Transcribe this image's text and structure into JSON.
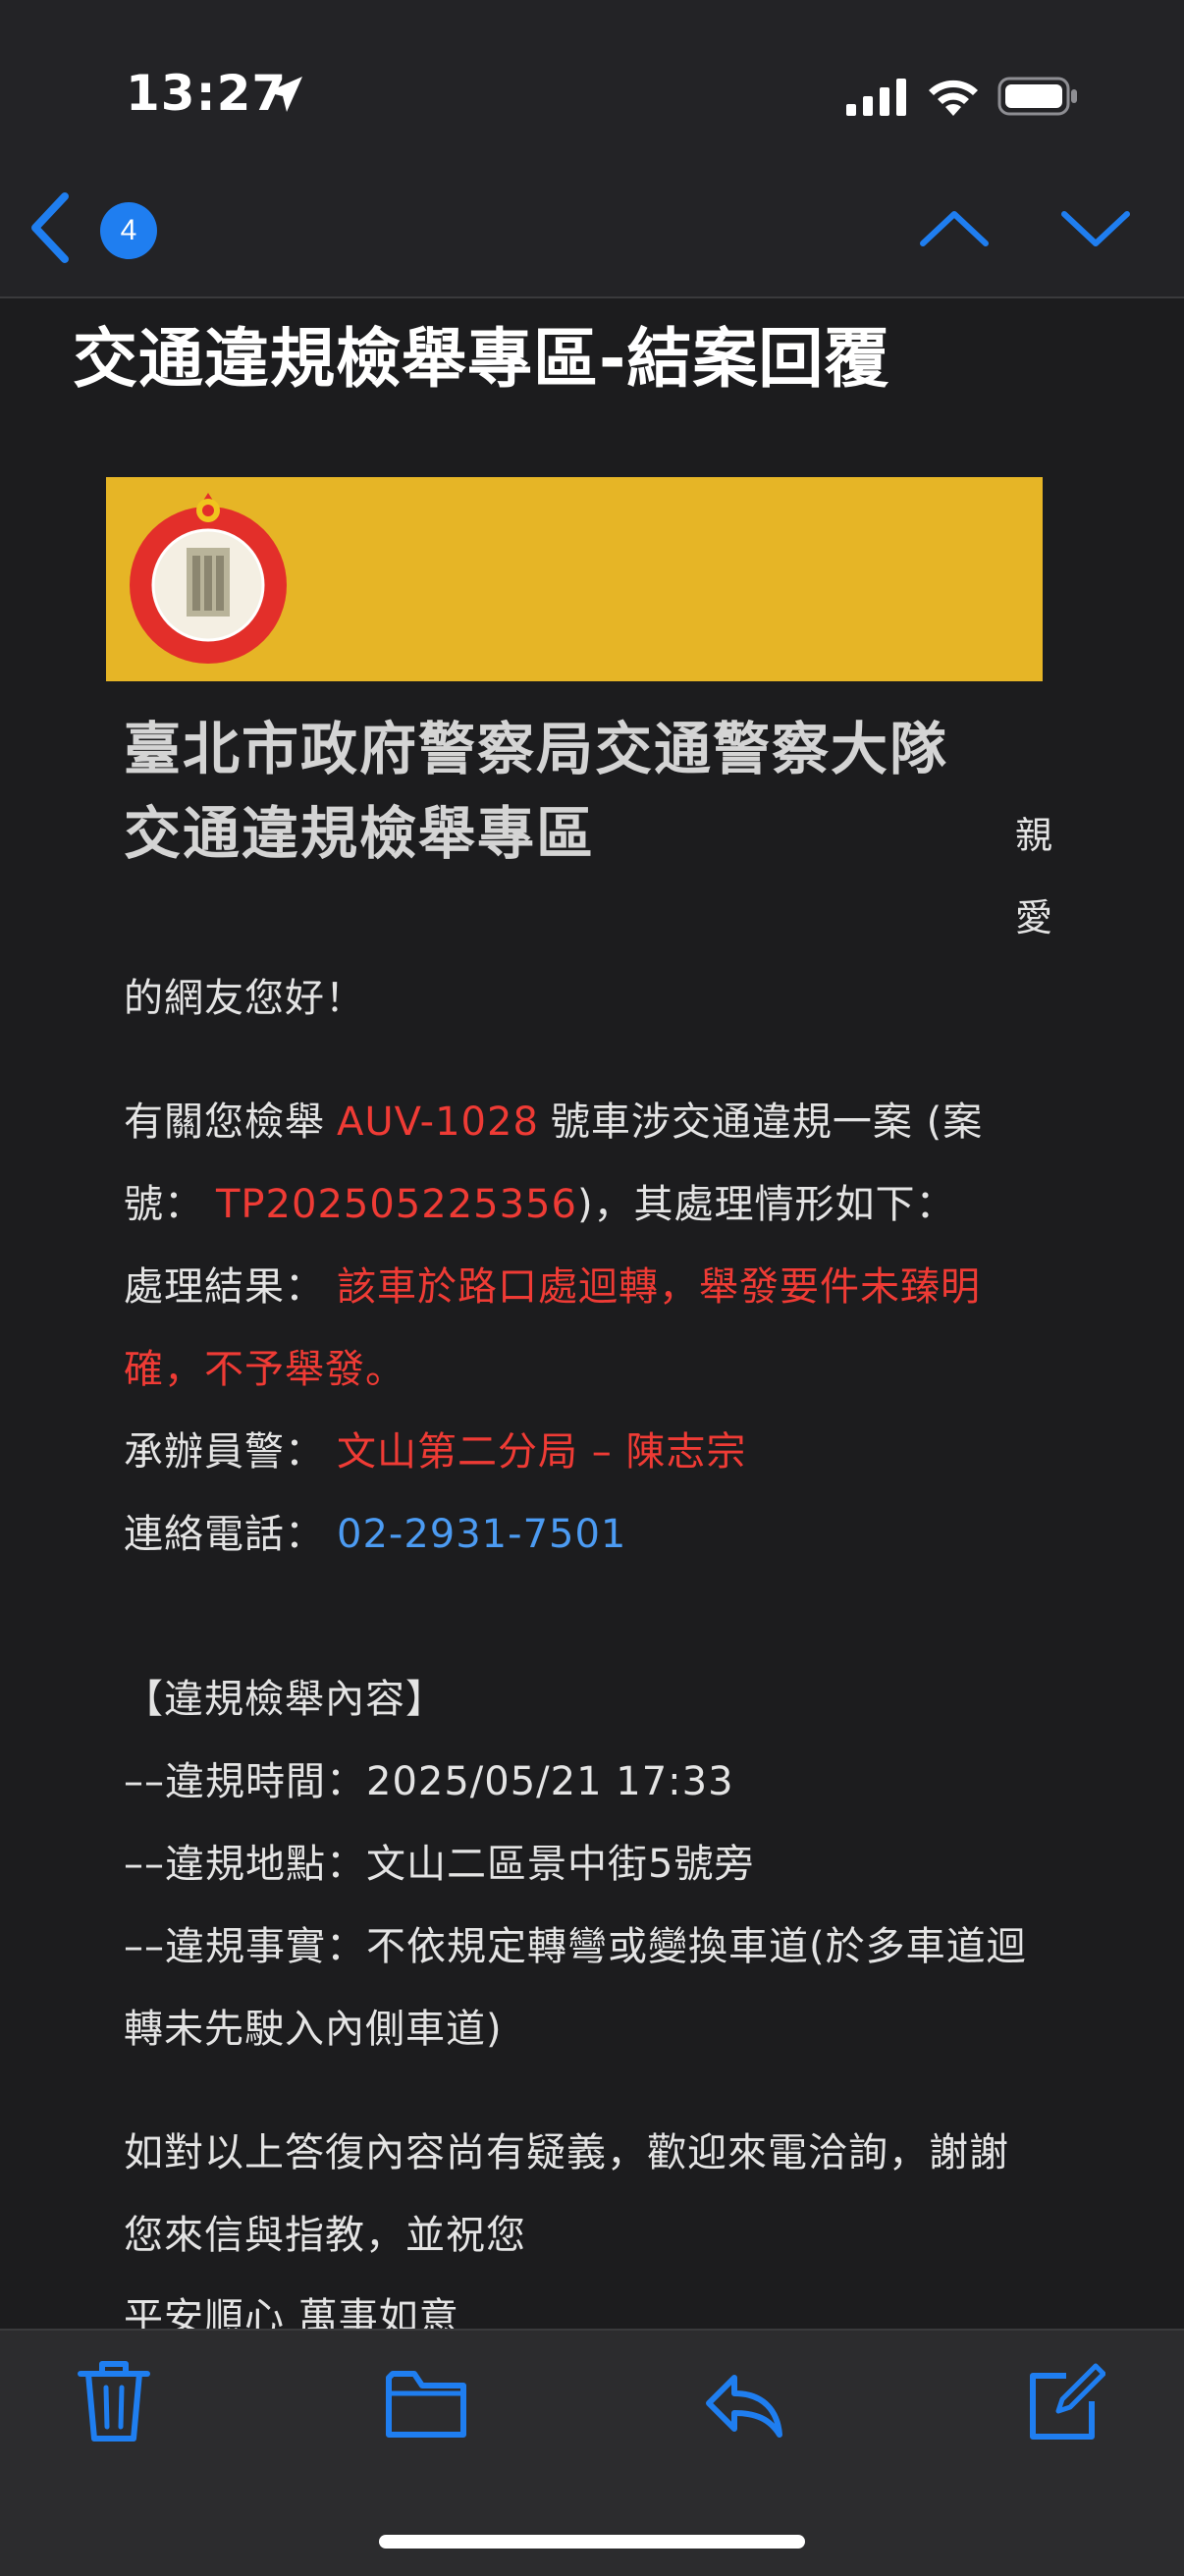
{
  "status_bar": {
    "time": "13:27"
  },
  "nav": {
    "unread_count": "4"
  },
  "email": {
    "subject": "交通違規檢舉專區-結案回覆",
    "org_line1": "臺北市政府警察局交通警察大隊",
    "org_line2": "交通違規檢舉專區",
    "greeting_char1": "親",
    "greeting_char2": "愛",
    "greeting_rest": "的網友您好！",
    "line1_prefix": "有關您檢舉",
    "plate": "AUV-1028",
    "line1_suffix": "號車涉交通違規一案 (案",
    "line2_prefix": "號：",
    "case_no": "TP202505225356",
    "line2_suffix": ")，其處理情形如下：",
    "result_label": "處理結果：",
    "result_text_1": "該車於路口處迴轉，舉發要件未臻明",
    "result_text_2": "確，不予舉發。",
    "officer_label": "承辦員警：",
    "officer_value": "文山第二分局 – 陳志宗",
    "phone_label": "連絡電話：",
    "phone_value": "02-2931-7501",
    "section_title": "【違規檢舉內容】",
    "violation_time": "––違規時間：2025/05/21 17:33",
    "violation_place": "––違規地點：文山二區景中街5號旁",
    "violation_fact_1": "––違規事實：不依規定轉彎或變換車道(於多車道迴",
    "violation_fact_2": "轉未先駛入內側車道)",
    "closing_1": "如對以上答復內容尚有疑義，歡迎來電洽詢，謝謝",
    "closing_2": "您來信與指教，並祝您",
    "closing_3": "平安順心 萬事如意"
  },
  "colors": {
    "accent": "#1f7ef0",
    "highlight_red": "#ef3b35",
    "link_blue": "#4c9bf2",
    "banner": "#e6b526",
    "background": "#1c1c1e"
  },
  "icons": {
    "back": "chevron-left-icon",
    "prev": "chevron-up-icon",
    "next": "chevron-down-icon",
    "toolbar": [
      "trash-icon",
      "folder-icon",
      "reply-icon",
      "compose-icon"
    ]
  }
}
